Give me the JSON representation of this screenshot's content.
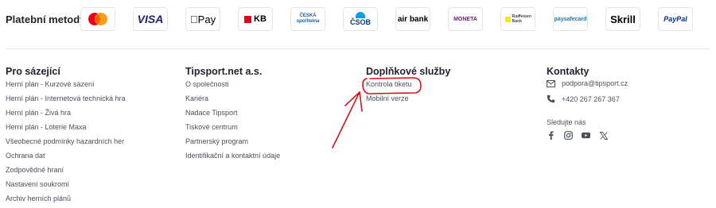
{
  "payments": {
    "title": "Platební metody",
    "logos": [
      {
        "name": "Mastercard"
      },
      {
        "name": "VISA"
      },
      {
        "name": "Pay"
      },
      {
        "name": "KB"
      },
      {
        "name": "ČESKÁ spořitelna"
      },
      {
        "name": "ČSOB"
      },
      {
        "name": "air bank"
      },
      {
        "name": "MONETA"
      },
      {
        "name": "Raiffeisen Bank"
      },
      {
        "name": "paysafecard"
      },
      {
        "name": "Skrill"
      },
      {
        "name": "PayPal"
      }
    ]
  },
  "columns": {
    "bettors": {
      "title": "Pro sázející",
      "links": [
        "Herní plán - Kurzové sázení",
        "Herní plán - Internetová technická hra",
        "Herní plán - Živá hra",
        "Herní plán - Loterie Maxa",
        "Všeobecné podmínky hazardních her",
        "Ochrana dat",
        "Zodpovědné hraní",
        "Nastavení soukromí",
        "Archiv herních plánů"
      ]
    },
    "company": {
      "title": "Tipsport.net a.s.",
      "links": [
        "O společnosti",
        "Kariéra",
        "Nadace Tipsport",
        "Tiskové centrum",
        "Partnerský program",
        "Identifikační a kontaktní údaje"
      ]
    },
    "services": {
      "title": "Doplňkové služby",
      "links": [
        "Kontrola tiketu",
        "Mobilní verze"
      ]
    },
    "contacts": {
      "title": "Kontakty",
      "email": "podpora@tipsport.cz",
      "phone": "+420 267 267 367",
      "follow_label": "Sledujte nás",
      "social": [
        "facebook-icon",
        "instagram-icon",
        "youtube-icon",
        "x-icon"
      ]
    }
  },
  "annotation_color": "#d0151b"
}
